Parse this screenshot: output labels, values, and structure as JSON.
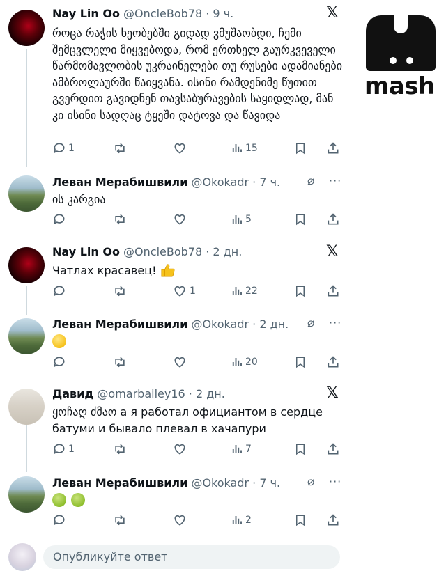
{
  "brand": {
    "watermark": "mash"
  },
  "colors": {
    "text": "#0f1419",
    "muted": "#536471",
    "divider": "#eff3f4",
    "thread_line": "#cfd9de"
  },
  "tweets": [
    {
      "author": "Nay Lin Oo",
      "handle": "@OncleBob78",
      "time": "· 9 ч.",
      "badge_icon": "x-logo-icon",
      "text": "როცა რაჭის ხეობებში გიდად ვმუშაობდი, ჩემი შემცვლელი მიყვებოდა, რომ ერთხელ გაურკვეველი წარმომავლობის უკრაინელები თუ რუსები ადამიანები ამბროლაურში წაიყვანა. ისინი რამდენიმე წუთით გვერდით გავიდნენ თავსაბურავების საყიდლად, მან კი ისინი სადღაც ტყეში დატოვა და წავიდა",
      "stats": {
        "replies": "1",
        "reposts": "",
        "likes": "",
        "views": "15"
      }
    },
    {
      "author": "Леван Мерабишвили",
      "handle": "@Okokadr",
      "time": "· 7 ч.",
      "badge_icon": "grok-icon",
      "text": "ის კარგია",
      "stats": {
        "replies": "",
        "reposts": "",
        "likes": "",
        "views": "5"
      }
    },
    {
      "author": "Nay Lin Oo",
      "handle": "@OncleBob78",
      "time": "· 2 дн.",
      "badge_icon": "x-logo-icon",
      "text": "Чатлах красавец!",
      "stats": {
        "replies": "",
        "reposts": "",
        "likes": "1",
        "views": "22"
      }
    },
    {
      "author": "Леван Мерабишвили",
      "handle": "@Okokadr",
      "time": "· 2 дн.",
      "badge_icon": "grok-icon",
      "text": "",
      "stats": {
        "replies": "",
        "reposts": "",
        "likes": "",
        "views": "20"
      }
    },
    {
      "author": "Давид",
      "handle": "@omarbailey16",
      "time": "· 2 дн.",
      "badge_icon": "x-logo-icon",
      "text": "ყოჩაღ ძმაო а я работал официантом в сердце батуми и бывало плевал в хачапури",
      "stats": {
        "replies": "1",
        "reposts": "",
        "likes": "",
        "views": "7"
      }
    },
    {
      "author": "Леван Мерабишвили",
      "handle": "@Okokadr",
      "time": "· 7 ч.",
      "badge_icon": "grok-icon",
      "text": "",
      "stats": {
        "replies": "",
        "reposts": "",
        "likes": "",
        "views": "2"
      }
    }
  ],
  "reply": {
    "placeholder": "Опубликуйте ответ"
  }
}
